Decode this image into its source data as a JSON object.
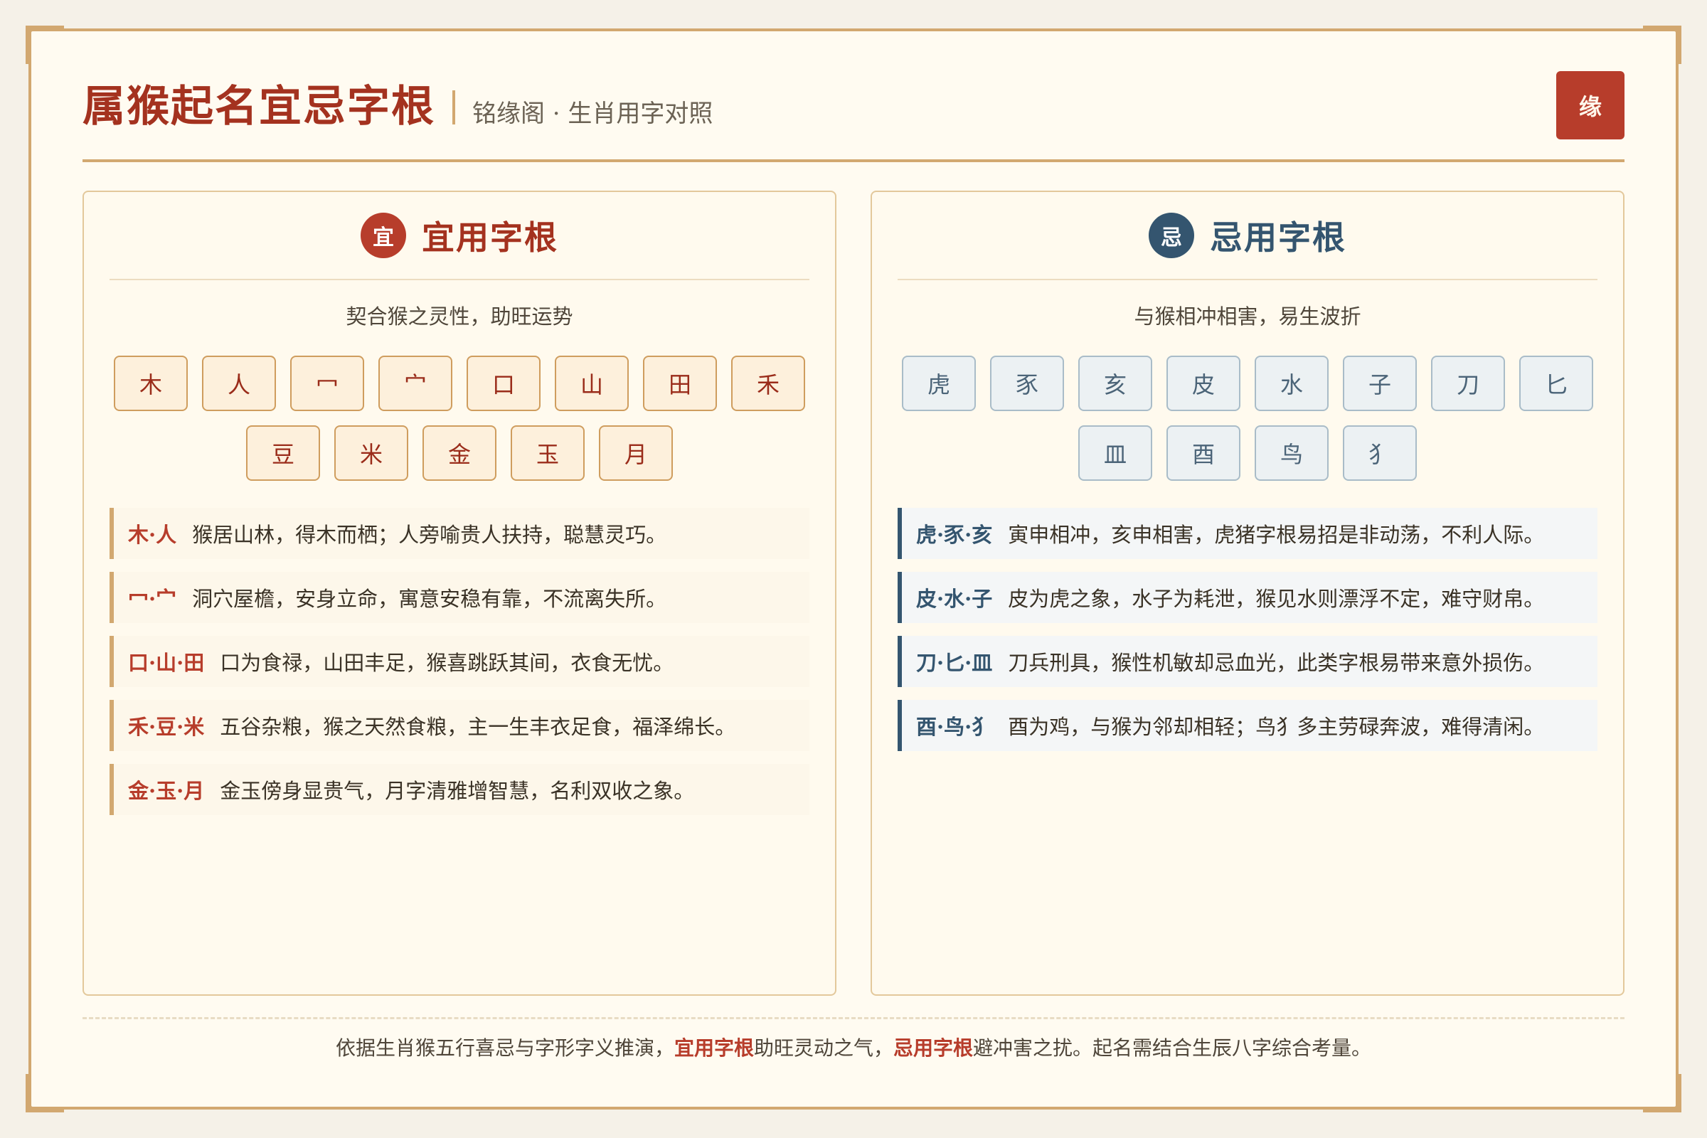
{
  "header": {
    "title": "属猴起名宜忌字根",
    "subtitle": "铭缘阁 · 生肖用字对照",
    "seal": "缘"
  },
  "good": {
    "badge": "宜",
    "title": "宜用字根",
    "desc": "契合猴之灵性，助旺运势",
    "chips": [
      "木",
      "人",
      "冖",
      "宀",
      "口",
      "山",
      "田",
      "禾",
      "豆",
      "米",
      "金",
      "玉",
      "月"
    ],
    "notes": [
      {
        "key": "木·人",
        "text": "猴居山林，得木而栖；人旁喻贵人扶持，聪慧灵巧。"
      },
      {
        "key": "冖·宀",
        "text": "洞穴屋檐，安身立命，寓意安稳有靠，不流离失所。"
      },
      {
        "key": "口·山·田",
        "text": "口为食禄，山田丰足，猴喜跳跃其间，衣食无忧。"
      },
      {
        "key": "禾·豆·米",
        "text": "五谷杂粮，猴之天然食粮，主一生丰衣足食，福泽绵长。"
      },
      {
        "key": "金·玉·月",
        "text": "金玉傍身显贵气，月字清雅增智慧，名利双收之象。"
      }
    ]
  },
  "bad": {
    "badge": "忌",
    "title": "忌用字根",
    "desc": "与猴相冲相害，易生波折",
    "chips": [
      "虎",
      "豕",
      "亥",
      "皮",
      "水",
      "子",
      "刀",
      "匕",
      "皿",
      "酉",
      "鸟",
      "犭"
    ],
    "notes": [
      {
        "key": "虎·豕·亥",
        "text": "寅申相冲，亥申相害，虎猪字根易招是非动荡，不利人际。"
      },
      {
        "key": "皮·水·子",
        "text": "皮为虎之象，水子为耗泄，猴见水则漂浮不定，难守财帛。"
      },
      {
        "key": "刀·匕·皿",
        "text": "刀兵刑具，猴性机敏却忌血光，此类字根易带来意外损伤。"
      },
      {
        "key": "酉·鸟·犭",
        "text": "酉为鸡，与猴为邻却相轻；鸟犭多主劳碌奔波，难得清闲。"
      }
    ]
  },
  "footer": {
    "part1": "依据生肖猴五行喜忌与字形字义推演，",
    "hl1": "宜用字根",
    "part2": "助旺灵动之气，",
    "hl2": "忌用字根",
    "part3": "避冲害之扰。起名需结合生辰八字综合考量。"
  },
  "colors": {
    "accent_red": "#b73d2b",
    "accent_blue": "#34556f",
    "border_gold": "#d2a870",
    "background": "#fffbf1"
  }
}
